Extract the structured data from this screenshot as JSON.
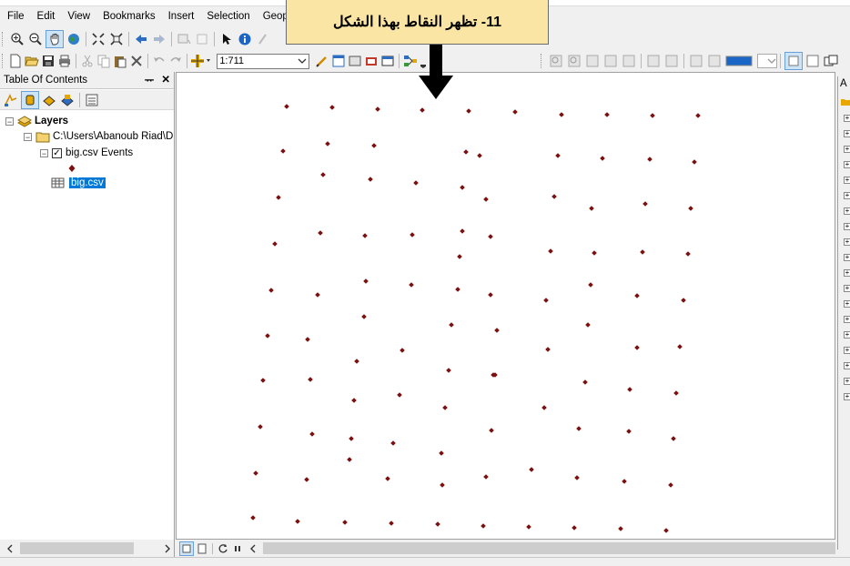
{
  "menu": {
    "items": [
      "File",
      "Edit",
      "View",
      "Bookmarks",
      "Insert",
      "Selection",
      "Geop"
    ]
  },
  "toolbar": {
    "scale_value": "1:711"
  },
  "toc": {
    "title": "Table Of Contents",
    "pin_glyph": "ᅲ",
    "close_glyph": "✕",
    "tree": {
      "root_label": "Layers",
      "folder_label": "C:\\Users\\Abanoub Riad\\D",
      "layer_label": "big.csv Events",
      "table_label": "big.csv"
    }
  },
  "annotation": {
    "text": "11- تظهر النقاط بهذا الشكل"
  },
  "right_panel": {
    "label": "A"
  },
  "colors": {
    "point": "#7a1010",
    "annotation_bg": "#fbe5a5",
    "selection": "#0078d7"
  },
  "map": {
    "point_symbol": "diamond",
    "point_count": 100
  }
}
